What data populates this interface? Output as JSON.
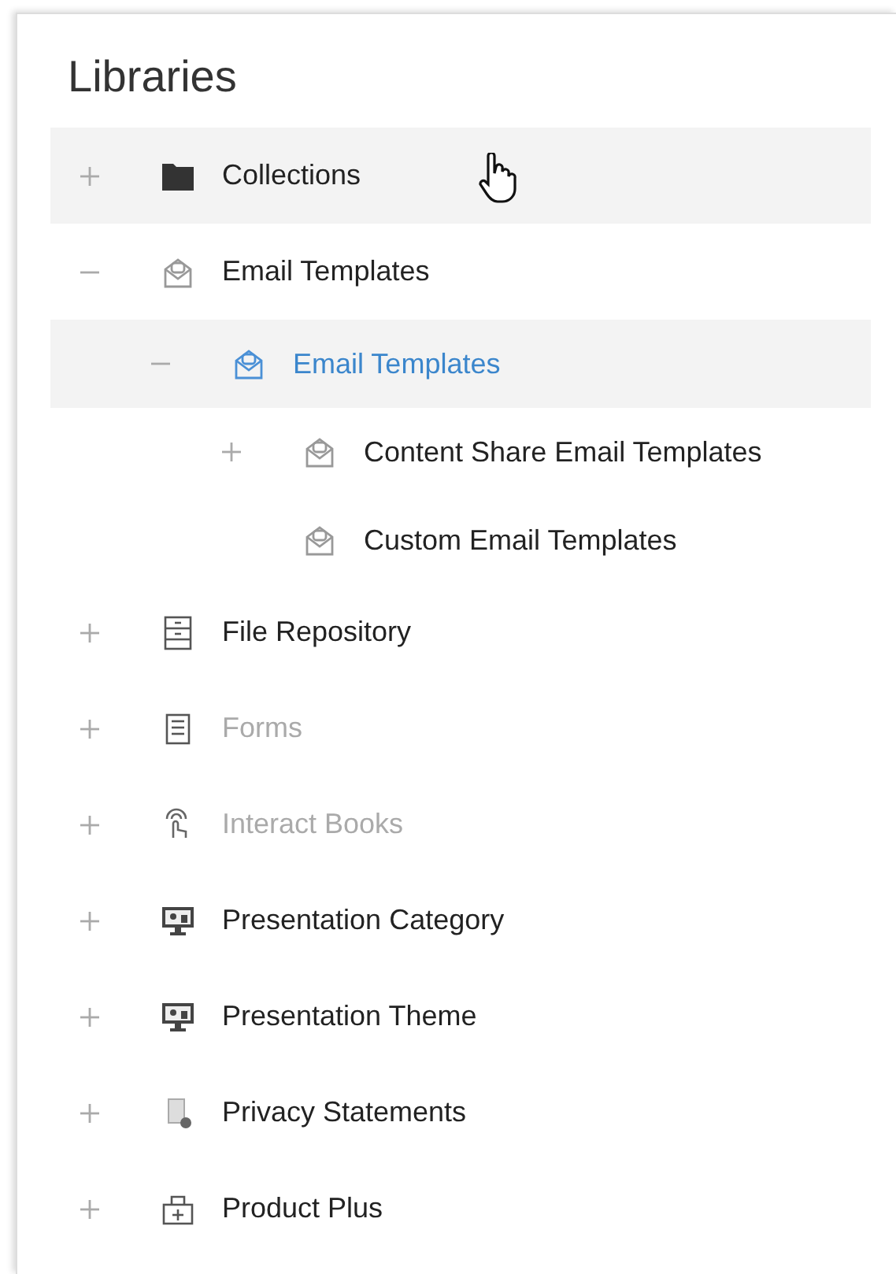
{
  "panel": {
    "title": "Libraries"
  },
  "tree": [
    {
      "label": "Collections",
      "kind": "folder",
      "expanded": false,
      "selected": false,
      "hovered": true,
      "disabled": false
    },
    {
      "label": "Email Templates",
      "kind": "email",
      "expanded": true,
      "selected": false,
      "hovered": false,
      "disabled": false,
      "children": [
        {
          "label": "Email Templates",
          "kind": "email",
          "expanded": true,
          "selected": true,
          "hovered": false,
          "disabled": false,
          "children": [
            {
              "label": "Content Share Email Templates",
              "kind": "email",
              "expanded": false,
              "selected": false,
              "hovered": false,
              "disabled": false
            },
            {
              "label": "Custom Email Templates",
              "kind": "email",
              "selected": false,
              "hovered": false,
              "disabled": false
            }
          ]
        }
      ]
    },
    {
      "label": "File Repository",
      "kind": "cabinet",
      "expanded": false,
      "selected": false,
      "hovered": false,
      "disabled": false
    },
    {
      "label": "Forms",
      "kind": "form",
      "expanded": false,
      "selected": false,
      "hovered": false,
      "disabled": true
    },
    {
      "label": "Interact Books",
      "kind": "touch",
      "expanded": false,
      "selected": false,
      "hovered": false,
      "disabled": true
    },
    {
      "label": "Presentation Category",
      "kind": "monitor",
      "expanded": false,
      "selected": false,
      "hovered": false,
      "disabled": false
    },
    {
      "label": "Presentation Theme",
      "kind": "monitor",
      "expanded": false,
      "selected": false,
      "hovered": false,
      "disabled": false
    },
    {
      "label": "Privacy Statements",
      "kind": "document",
      "expanded": false,
      "selected": false,
      "hovered": false,
      "disabled": false
    },
    {
      "label": "Product Plus",
      "kind": "box",
      "expanded": false,
      "selected": false,
      "hovered": false,
      "disabled": false
    }
  ]
}
